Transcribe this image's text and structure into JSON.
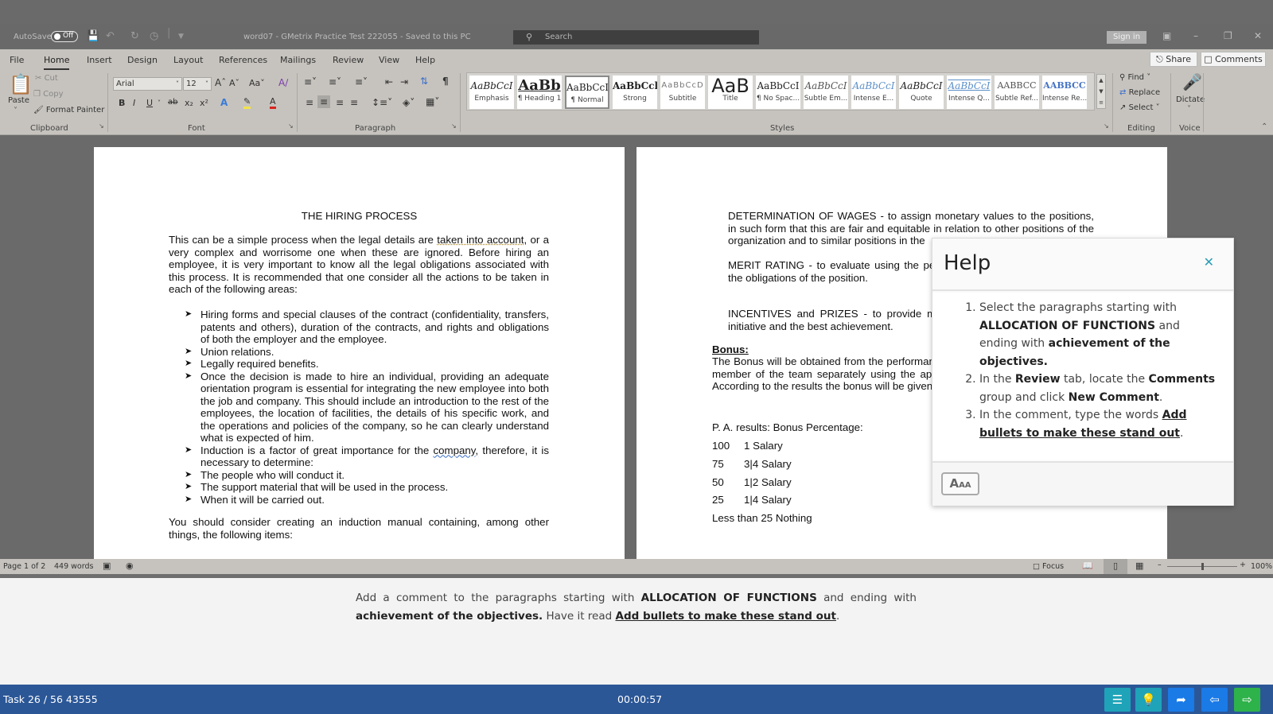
{
  "titlebar": {
    "autosave_label": "AutoSave",
    "autosave_state": "Off",
    "document_title": "word07  -  GMetrix Practice Test 222055  -  Saved to this PC",
    "search_placeholder": "Search",
    "signin_label": "Sign in"
  },
  "menu": {
    "tabs": [
      "File",
      "Home",
      "Insert",
      "Design",
      "Layout",
      "References",
      "Mailings",
      "Review",
      "View",
      "Help"
    ],
    "active_tab": "Home",
    "share_label": "Share",
    "comments_label": "Comments"
  },
  "ribbon": {
    "clipboard": {
      "paste": "Paste",
      "cut": "Cut",
      "copy": "Copy",
      "format_painter": "Format Painter",
      "group_label": "Clipboard"
    },
    "font": {
      "font_name": "Arial",
      "font_size": "12",
      "group_label": "Font",
      "change_case": "Aa"
    },
    "paragraph": {
      "group_label": "Paragraph"
    },
    "styles": {
      "group_label": "Styles",
      "items": [
        {
          "preview": "AaBbCcI",
          "label": "Emphasis"
        },
        {
          "preview": "AaBb",
          "label": "¶ Heading 1"
        },
        {
          "preview": "AaBbCcI",
          "label": "¶ Normal"
        },
        {
          "preview": "AaBbCcl",
          "label": "Strong"
        },
        {
          "preview": "AaBbCcD",
          "label": "Subtitle"
        },
        {
          "preview": "AaB",
          "label": "Title"
        },
        {
          "preview": "AaBbCcI",
          "label": "¶ No Spac..."
        },
        {
          "preview": "AaBbCcI",
          "label": "Subtle Em..."
        },
        {
          "preview": "AaBbCcI",
          "label": "Intense E..."
        },
        {
          "preview": "AaBbCcI",
          "label": "Quote"
        },
        {
          "preview": "AaBbCcI",
          "label": "Intense Q..."
        },
        {
          "preview": "AABBCC",
          "label": "Subtle Ref..."
        },
        {
          "preview": "AABBCC",
          "label": "Intense Re..."
        }
      ],
      "selected": "¶ Normal"
    },
    "editing": {
      "find": "Find",
      "replace": "Replace",
      "select": "Select",
      "group_label": "Editing"
    },
    "voice": {
      "dictate": "Dictate",
      "group_label": "Voice"
    }
  },
  "page1": {
    "title": "THE HIRING PROCESS",
    "intro_before": "This can be a simple process when the legal details are ",
    "intro_flagged": "taken into account",
    "intro_after": ", or a very complex and worrisome one when these are ignored. Before hiring an employee, it is very important to know all the legal obligations associated with this process. It is recommended that one consider all the actions to be taken in each of the following areas:",
    "bullets": [
      "Hiring forms and special clauses of the contract (confidentiality, transfers, patents and others), duration of the contracts, and rights and obligations of both the employer and the employee.",
      "Union relations.",
      "Legally required benefits.",
      "Once the decision is made to hire an individual, providing an adequate orientation program is essential for integrating the new employee into both the job and company. This should include an introduction to the rest of the employees, the location of facilities, the details of his specific work, and the operations and policies of the company, so he can clearly understand what is expected of him.",
      "Induction is a factor of great importance for the ",
      "The people who will conduct it.",
      "The support material that will be used in the process.",
      "When it will be carried out."
    ],
    "induction_flagged": "company,",
    "induction_after": " therefore, it is necessary to determine:",
    "closing": "You should consider creating an induction manual containing, among other things, the following items:"
  },
  "page2": {
    "wages": "DETERMINATION OF WAGES - to assign monetary values to the positions, in such form that this are fair and equitable in relation to other positions of the organization and to similar positions in the",
    "merit": "MERIT RATING - to evaluate using the performance of each worker before the obligations of the position.",
    "incentives": "INCENTIVES and PRIZES - to provide monetary rewards to motivate the initiative and the best achievement.",
    "bonus_heading": "Bonus:",
    "bonus_text": "The Bonus will be obtained from the performance appraisal year evaluating each member of the team separately using the appraisal that I created in page 26. According to the results the bonus will be given:",
    "pa_header": "P. A. results: Bonus Percentage:",
    "pa_rows": [
      {
        "score": "100",
        "bonus": "1 Salary"
      },
      {
        "score": "75",
        "bonus": "3|4 Salary"
      },
      {
        "score": "50",
        "bonus": "1|2 Salary"
      },
      {
        "score": "25",
        "bonus": "1|4 Salary"
      }
    ],
    "pa_last": "Less than 25 Nothing"
  },
  "help": {
    "title": "Help",
    "step1_a": "Select the paragraphs starting with ",
    "step1_b": "ALLOCATION OF FUNCTIONS",
    "step1_c": " and ending with ",
    "step1_d": "achievement of the objectives.",
    "step2_a": "In the ",
    "step2_b": "Review",
    "step2_c": " tab, locate the ",
    "step2_d": "Comments",
    "step2_e": " group and click ",
    "step2_f": "New Comment",
    "step2_g": ".",
    "step3_a": "In the comment, type the words ",
    "step3_b": "Add bullets to make these stand out",
    "step3_c": ".",
    "font_size_button": "A",
    "font_size_button_small": "AA"
  },
  "statusbar": {
    "page": "Page 1 of 2",
    "words": "449 words",
    "focus": "Focus",
    "zoom": "100%",
    "zoom_level_percent": 100
  },
  "instruction": {
    "a": "Add a comment to the paragraphs starting with ",
    "b": "ALLOCATION OF FUNCTIONS",
    "c": " and ending with ",
    "d": "achievement of the objectives.",
    "e": " Have it read ",
    "f": "Add bullets to make these stand out",
    "g": "."
  },
  "bottombar": {
    "task": "Task 26 / 56 43555",
    "timer": "00:00:57",
    "colors": {
      "bar": "#2b5797",
      "teal": "#1fa3b8",
      "blue": "#1a7ae6",
      "green": "#2eb24a"
    }
  }
}
